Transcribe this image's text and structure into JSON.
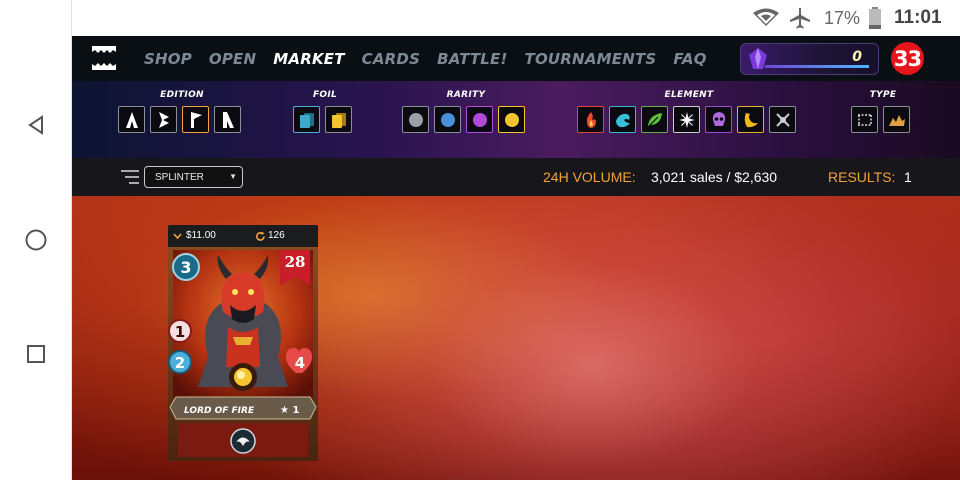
{
  "status_bar": {
    "battery": "17%",
    "time": "11:01"
  },
  "nav": {
    "menu": [
      "SHOP",
      "OPEN",
      "MARKET",
      "CARDS",
      "BATTLE!",
      "TOURNAMENTS",
      "FAQ"
    ],
    "active": "MARKET",
    "mana_value": "0",
    "notification_count": "33"
  },
  "filters": {
    "edition_title": "EDITION",
    "foil_title": "FOIL",
    "rarity_title": "RARITY",
    "element_title": "ELEMENT",
    "type_title": "TYPE",
    "rarity_colors": [
      "#9aa0a6",
      "#4a90d9",
      "#b04ad9",
      "#f2c430"
    ],
    "element_icons": [
      "fire-icon",
      "water-icon",
      "earth-icon",
      "life-icon",
      "death-icon",
      "dragon-icon",
      "neutral-icon"
    ]
  },
  "info_bar": {
    "sort_select": "SPLINTER",
    "volume_label": "24H VOLUME:",
    "volume_value": "3,021 sales / $2,630",
    "results_label": "RESULTS:",
    "results_value": "1"
  },
  "card": {
    "price": "$11.00",
    "quantity": "126",
    "mana": "3",
    "level": "28",
    "attack": "1",
    "speed": "2",
    "health": "4",
    "name": "LORD OF FIRE",
    "stars": "★ 1"
  }
}
